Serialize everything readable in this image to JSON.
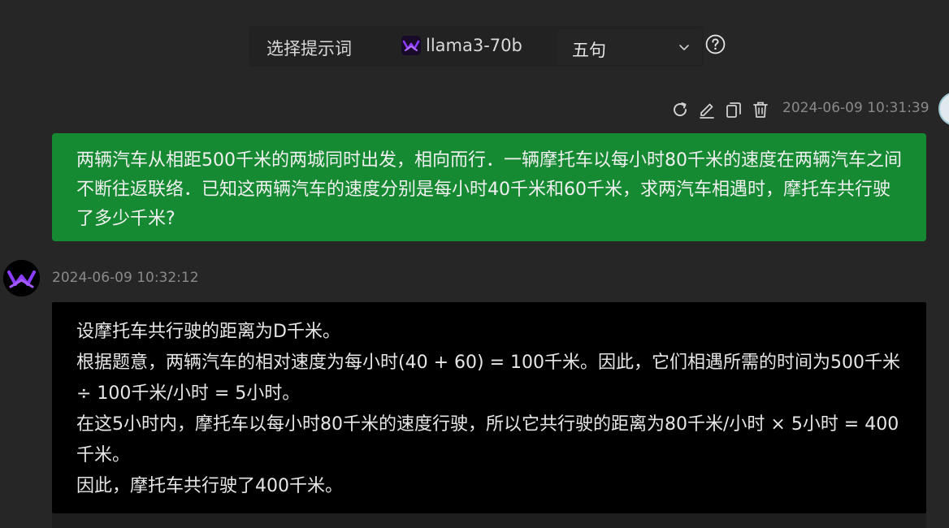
{
  "toolbar": {
    "prompt_select_label": "选择提示词",
    "model_label": "llama3-70b",
    "model_icon": "meta-purple-icon",
    "sentence_select": {
      "value": "五句"
    },
    "help_icon": "question-circle-icon"
  },
  "user_message": {
    "timestamp": "2024-06-09 10:31:39",
    "actions": [
      "refresh-icon",
      "edit-icon",
      "copy-icon",
      "delete-icon"
    ],
    "text": "两辆汽车从相距500千米的两城同时出发，相向而行．一辆摩托车以每小时80千米的速度在两辆汽车之间不断往返联络．已知这两辆汽车的速度分别是每小时40千米和60千米，求两汽车相遇时，摩托车共行驶了多少千米?",
    "bubble_color": "#168a32"
  },
  "bot_message": {
    "timestamp": "2024-06-09 10:32:12",
    "lines": [
      "设摩托车共行驶的距离为D千米。",
      "根据题意，两辆汽车的相对速度为每小时(40 + 60) = 100千米。因此，它们相遇所需的时间为500千米 ÷ 100千米/小时 = 5小时。",
      "在这5小时内，摩托车以每小时80千米的速度行驶，所以它共行驶的距离为80千米/小时 × 5小时 = 400千米。",
      "因此，摩托车共行驶了400千米。"
    ],
    "bubble_color": "#000000"
  },
  "colors": {
    "background": "#262626",
    "accent_purple": "#7b2ff7",
    "timestamp": "#8a8a8a"
  }
}
